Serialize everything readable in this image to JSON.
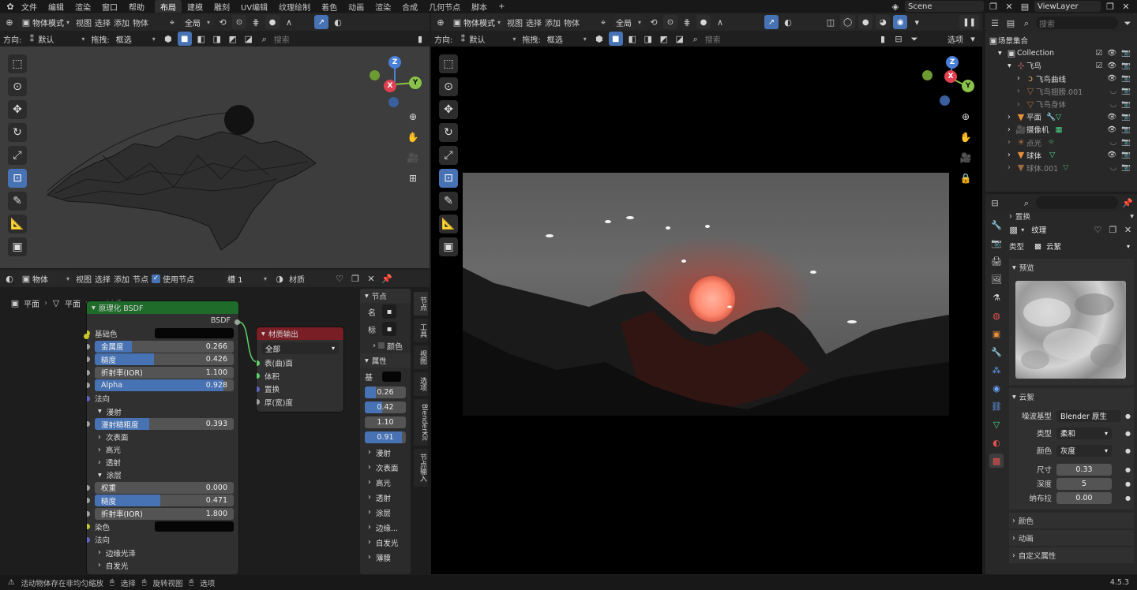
{
  "menu": {
    "items": [
      "文件",
      "编辑",
      "渲染",
      "窗口",
      "帮助"
    ],
    "workspaces": [
      "布局",
      "建模",
      "雕刻",
      "UV编辑",
      "纹理绘制",
      "着色",
      "动画",
      "渲染",
      "合成",
      "几何节点",
      "脚本"
    ],
    "active_workspace": "布局",
    "add_tab": "+",
    "scene_name": "Scene",
    "view_layer": "ViewLayer"
  },
  "viewport_left": {
    "mode": "物体模式",
    "menus": [
      "视图",
      "选择",
      "添加",
      "物体"
    ],
    "transform_orientation": "全局",
    "direction_label": "方向:",
    "direction_value": "默认",
    "drag_label": "拖拽:",
    "drag_value": "框选",
    "search_placeholder": "搜索"
  },
  "viewport_right": {
    "mode": "物体模式",
    "menus": [
      "视图",
      "选择",
      "添加",
      "物体"
    ],
    "transform_orientation": "全局",
    "direction_label": "方向:",
    "direction_value": "默认",
    "drag_label": "拖拽:",
    "drag_value": "框选",
    "search_placeholder": "搜索",
    "options_label": "选项"
  },
  "gizmo": {
    "x": "X",
    "y": "Y",
    "z": "Z"
  },
  "node_editor": {
    "object_type": "物体",
    "menus": [
      "视图",
      "选择",
      "添加",
      "节点"
    ],
    "use_nodes_label": "使用节点",
    "slot": "槽 1",
    "material_label": "材质",
    "breadcrumb": [
      "平面",
      "平面",
      "材质"
    ],
    "bsdf_node": {
      "title": "原理化 BSDF",
      "output_label": "BSDF",
      "base_color_label": "基础色",
      "metallic": {
        "label": "金属度",
        "value": "0.266",
        "fraction": 0.266
      },
      "roughness": {
        "label": "糙度",
        "value": "0.426",
        "fraction": 0.426
      },
      "ior": {
        "label": "折射率(IOR)",
        "value": "1.100",
        "fraction": 0
      },
      "alpha": {
        "label": "Alpha",
        "value": "0.928",
        "fraction": 0.928
      },
      "normal_label": "法向",
      "diffuse_section": "漫射",
      "diffuse_roughness": {
        "label": "漫射糙粗度",
        "value": "0.393",
        "fraction": 0.393
      },
      "collapsed_sections": [
        "次表面",
        "高光",
        "透射"
      ],
      "coat_section": "涂层",
      "coat_weight": {
        "label": "权重",
        "value": "0.000",
        "fraction": 0
      },
      "coat_roughness": {
        "label": "糙度",
        "value": "0.471",
        "fraction": 0.471
      },
      "coat_ior": {
        "label": "折射率(IOR)",
        "value": "1.800",
        "fraction": 0
      },
      "tint_label": "染色",
      "coat_normal_label": "法向",
      "sheen_section": "边缘光泽",
      "emission_section": "自发光"
    },
    "output_node": {
      "title": "材质输出",
      "target": "全部",
      "sockets": [
        "表(曲)面",
        "体积",
        "置换",
        "厚(宽)度"
      ]
    },
    "sidebar": {
      "node_panel": "节点",
      "name_label": "名",
      "label_label": "标",
      "color_label": "颜色",
      "props_panel": "属性",
      "base_label": "基",
      "values": [
        {
          "value": "0.26",
          "fraction": 0.26
        },
        {
          "value": "0.42",
          "fraction": 0.42
        },
        {
          "value": "1.10",
          "fraction": 0
        },
        {
          "value": "0.91",
          "fraction": 0.91
        }
      ],
      "sections": [
        "漫射",
        "次表面",
        "高光",
        "透射",
        "涂层",
        "边缘...",
        "自发光",
        "薄膜"
      ]
    },
    "side_tabs": [
      "节点",
      "工具",
      "视图",
      "选项",
      "BlenderKit",
      "节点输入"
    ]
  },
  "outliner": {
    "search_placeholder": "搜索",
    "scene_collection": "场景集合",
    "items": [
      {
        "name": "Collection",
        "indent": 1,
        "icon": "collection-icon"
      },
      {
        "name": "飞鸟",
        "indent": 2,
        "icon": "empty-icon"
      },
      {
        "name": "飞鸟曲线",
        "indent": 3,
        "icon": "curve-icon"
      },
      {
        "name": "飞鸟翅膀.001",
        "indent": 3,
        "icon": "mesh-icon"
      },
      {
        "name": "飞鸟身体",
        "indent": 3,
        "icon": "mesh-icon"
      },
      {
        "name": "平面",
        "indent": 2,
        "icon": "mesh-icon"
      },
      {
        "name": "摄像机",
        "indent": 2,
        "icon": "camera-icon"
      },
      {
        "name": "点光",
        "indent": 2,
        "icon": "light-icon"
      },
      {
        "name": "球体",
        "indent": 2,
        "icon": "mesh-icon"
      },
      {
        "name": "球体.001",
        "indent": 2,
        "icon": "mesh-icon"
      }
    ]
  },
  "properties": {
    "replace_label": "置换",
    "texture_label": "纹理",
    "type_label": "类型",
    "type_value": "云絮",
    "preview_panel": "预览",
    "clouds_panel": "云絮",
    "noise_basis_label": "噪波基型",
    "noise_basis_value": "Blender 原生",
    "noise_type_label": "类型",
    "noise_type_value": "柔和",
    "color_label": "颜色",
    "color_value": "灰度",
    "size_label": "尺寸",
    "size_value": "0.33",
    "depth_label": "深度",
    "depth_value": "5",
    "nabla_label": "纳布拉",
    "nabla_value": "0.00",
    "collapsed_panels": [
      "颜色",
      "动画",
      "自定义属性"
    ]
  },
  "status": {
    "warning": "活动物体存在非均匀缩放",
    "select": "选择",
    "rotate": "旋转视图",
    "options": "选项",
    "version": "4.5.3"
  },
  "colors": {
    "accent": "#4772b3",
    "bsdf_header": "#1e6b2a",
    "output_header": "#7a1e26",
    "sun": "#ff8a70"
  }
}
